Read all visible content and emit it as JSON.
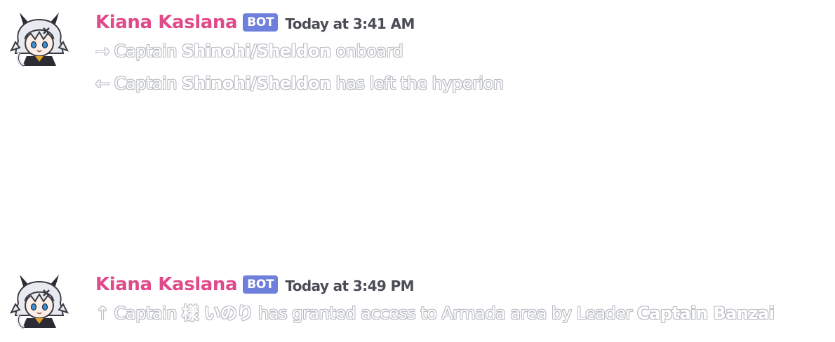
{
  "messages": [
    {
      "author": "Kiana Kaslana",
      "bot_tag": "BOT",
      "timestamp": "Today at 3:41 AM",
      "lines": [
        {
          "prefix": "→ Captain ",
          "name": "Shinohi/Sheldon",
          "suffix": " onboard"
        },
        {
          "prefix": "← Captain ",
          "name": "Shinohi/Sheldon",
          "suffix": " has left the hyperion"
        }
      ]
    },
    {
      "author": "Kiana Kaslana",
      "bot_tag": "BOT",
      "timestamp": "Today at 3:49 PM",
      "line": {
        "prefix": "↑ Captain ",
        "name": "樣 いのり",
        "middle": " has granted access to Armada area by Leader ",
        "leader": "Captain Banzai"
      }
    }
  ],
  "colors": {
    "username": "#e04a8a",
    "bot_tag_bg": "#6f7fdc",
    "timestamp": "#4a4d55",
    "text_outline": "#b9bcc3"
  },
  "icons": {
    "avatar": "kiana-avatar-icon"
  }
}
